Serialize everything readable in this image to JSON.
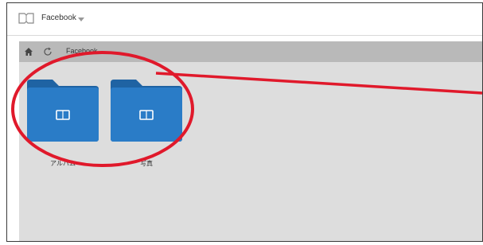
{
  "window": {
    "title": "Facebook"
  },
  "toolbar": {
    "breadcrumb": "Facebook"
  },
  "folders": [
    {
      "label": "アルバム",
      "icon": "album-icon"
    },
    {
      "label": "写真",
      "icon": "album-icon"
    }
  ],
  "colors": {
    "folder_blue": "#2a7cc7",
    "folder_tab": "#1f63a3",
    "toolbar_gray": "#b9b9b9",
    "content_gray": "#dddddd",
    "annotation_red": "#e0192b"
  },
  "icons": [
    "app-book-icon",
    "dropdown-caret-icon",
    "home-icon",
    "refresh-icon",
    "folder-icon",
    "album-icon"
  ]
}
